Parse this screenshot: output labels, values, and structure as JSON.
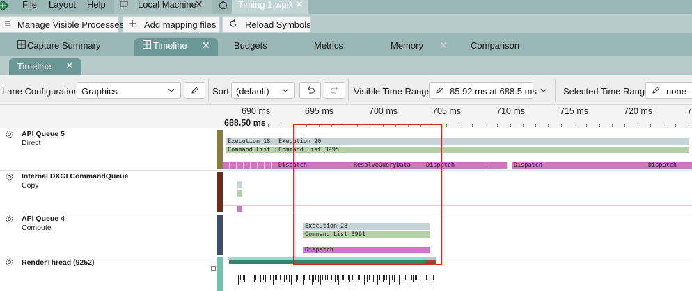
{
  "menu": {
    "file": "File",
    "layout": "Layout",
    "help": "Help"
  },
  "doc_tabs": [
    {
      "title": "Local Machine",
      "close": "✕"
    },
    {
      "title": "Timing 1.wpix",
      "dirty": "*",
      "close": "✕"
    }
  ],
  "toolbar": {
    "manage": "Manage Visible Processes",
    "add_mapping": "Add mapping files",
    "reload": "Reload Symbols"
  },
  "view_tabs": [
    "Capture Summary",
    "Timeline",
    "Budgets",
    "Metrics",
    "Memory",
    "Comparison"
  ],
  "view_tab_close": "✕",
  "sub_tab": {
    "label": "Timeline",
    "close": "✕"
  },
  "controls": {
    "lane_config_label": "Lane Configuration",
    "lane_config_value": "Graphics",
    "sort_label": "Sort",
    "sort_value": "(default)",
    "visible_range_label": "Visible Time Range:",
    "visible_range_value": "85.92 ms at 688.5 ms",
    "selected_range_label": "Selected Time Range:",
    "selected_range_value": "none"
  },
  "ruler": {
    "ticks": [
      "690 ms",
      "695 ms",
      "700 ms",
      "705 ms",
      "710 ms",
      "715 ms",
      "720 ms",
      "7"
    ],
    "cursor": "688.50 ms"
  },
  "lanes": [
    {
      "name": "API Queue 5",
      "type": "Direct",
      "color": "#867c3e"
    },
    {
      "name": "Internal DXGI CommandQueue",
      "type": "Copy",
      "color": "#6e2a12"
    },
    {
      "name": "API Queue 4",
      "type": "Compute",
      "color": "#3b4e6b"
    },
    {
      "name": "RenderThread (9252)",
      "type": "",
      "color": "#6fc2b0"
    }
  ],
  "events": {
    "q5_exec1": "Execution 18",
    "q5_exec2": "Execution 20",
    "q5_cmd1": "Command List :",
    "q5_cmd2": "Command List 3995",
    "q5_d1": "Dispatch",
    "q5_d2": "ResolveQueryData",
    "q5_d3": "Dispatch",
    "q5_d4": "Dispatch",
    "q5_d5": "Dispatch",
    "q4_exec": "Execution 23",
    "q4_cmd": "Command List 3991",
    "q4_disp": "Dispatch"
  },
  "colors": {
    "menubar": "#9bb6b6",
    "active_tab": "#6c9797",
    "execution": "#c6d4d8",
    "command_list": "#b5d0a8",
    "dispatch": "#cc77c6",
    "selection": "#d9262e"
  }
}
